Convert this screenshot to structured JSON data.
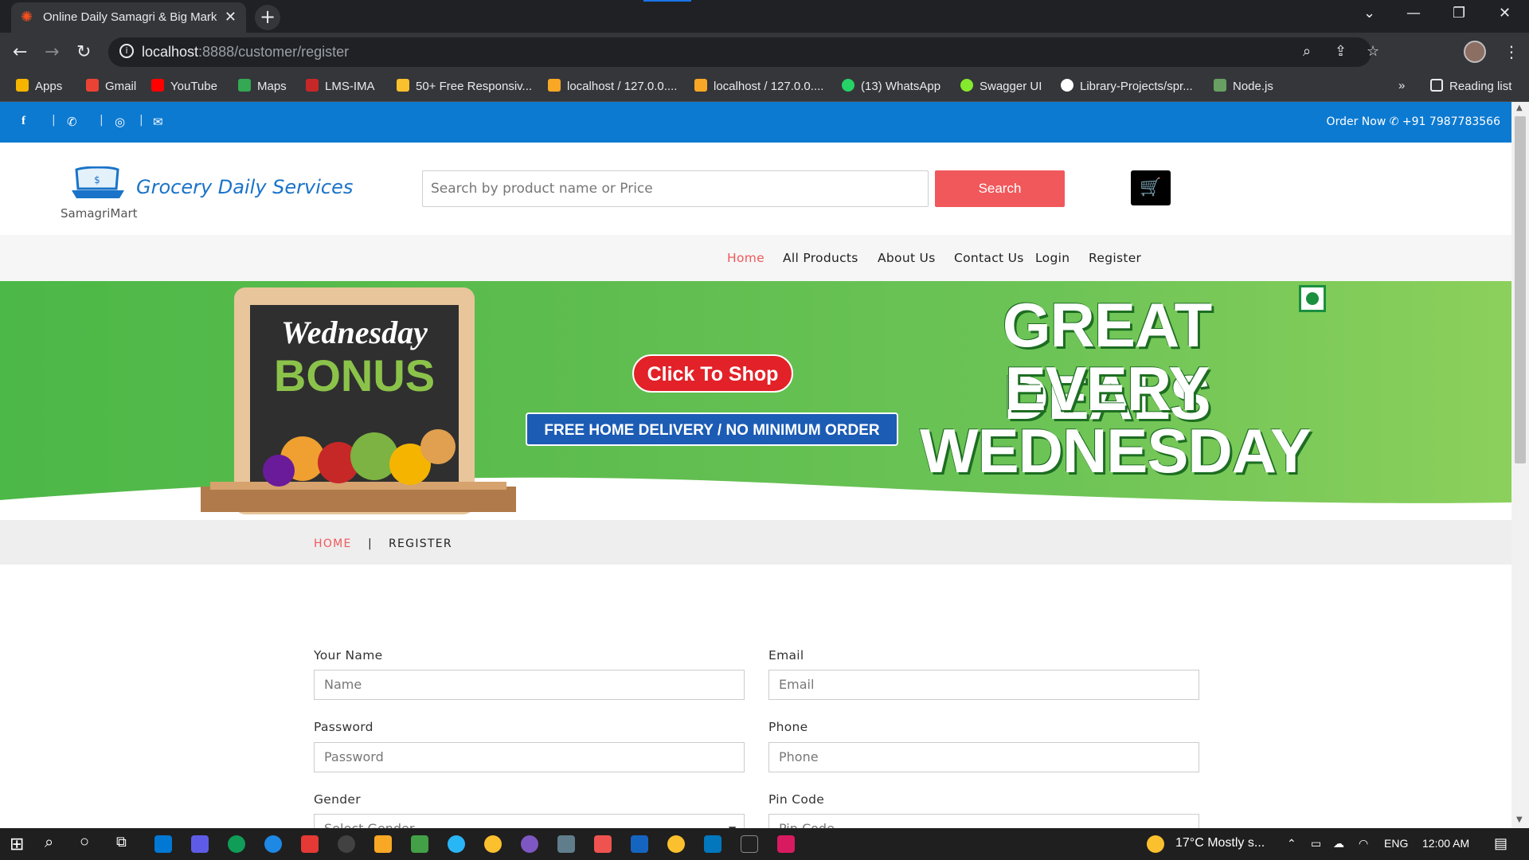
{
  "browser": {
    "tab_title": "Online Daily Samagri & Big Mark",
    "url_host": "localhost",
    "url_rest": ":8888/customer/register",
    "bookmarks": [
      {
        "label": "Apps",
        "icon": "apps-grid-icon",
        "color": "#f4b400"
      },
      {
        "label": "Gmail",
        "icon": "gmail-icon",
        "color": "#ea4335"
      },
      {
        "label": "YouTube",
        "icon": "youtube-icon",
        "color": "#ff0000"
      },
      {
        "label": "Maps",
        "icon": "maps-icon",
        "color": "#34a853"
      },
      {
        "label": "LMS-IMA",
        "icon": "lms-icon",
        "color": "#c62828"
      },
      {
        "label": "50+ Free Responsiv...",
        "icon": "template-icon",
        "color": "#fbc02d"
      },
      {
        "label": "localhost / 127.0.0....",
        "icon": "phpmyadmin-icon",
        "color": "#f9a825"
      },
      {
        "label": "localhost / 127.0.0....",
        "icon": "phpmyadmin-icon",
        "color": "#f9a825"
      },
      {
        "label": "(13) WhatsApp",
        "icon": "whatsapp-icon",
        "color": "#25d366"
      },
      {
        "label": "Swagger UI",
        "icon": "swagger-icon",
        "color": "#85ea2d"
      },
      {
        "label": "Library-Projects/spr...",
        "icon": "github-icon",
        "color": "#ffffff"
      },
      {
        "label": "Node.js",
        "icon": "nodejs-icon",
        "color": "#68a063"
      }
    ],
    "more": "»",
    "reading_list": "Reading list"
  },
  "topbar": {
    "order_label": "Order Now",
    "phone": "+91 7987783566"
  },
  "header": {
    "logo_title": "Grocery Daily Services",
    "logo_sub": "SamagriMart",
    "search_placeholder": "Search by product name or Price",
    "search_button": "Search"
  },
  "nav": {
    "items": [
      "Home",
      "All Products",
      "About Us",
      "Contact Us",
      "Login",
      "Register"
    ],
    "active": "Home"
  },
  "banner": {
    "board_line1": "Wednesday",
    "board_line2": "BONUS",
    "shop_button": "Click To Shop",
    "delivery_left": "FREE HOME DELIVERY",
    "delivery_right": "NO MINIMUM ORDER",
    "deals_line1": "GREAT DEALS",
    "deals_line2": "EVERY",
    "deals_line3": "WEDNESDAY"
  },
  "breadcrumb": {
    "home": "HOME",
    "separator": "|",
    "current": "REGISTER"
  },
  "form": {
    "name_label": "Your Name",
    "name_placeholder": "Name",
    "email_label": "Email",
    "email_placeholder": "Email",
    "password_label": "Password",
    "password_placeholder": "Password",
    "phone_label": "Phone",
    "phone_placeholder": "Phone",
    "gender_label": "Gender",
    "gender_value": "Select Gender",
    "pincode_label": "Pin Code",
    "pincode_placeholder": "Pin Code"
  },
  "taskbar": {
    "weather": "17°C  Mostly s...",
    "language": "ENG",
    "time": "12:00 AM"
  },
  "colors": {
    "brand_blue": "#0c7ad1",
    "accent_red": "#f1585b",
    "banner_green": "#5fbd4f"
  }
}
